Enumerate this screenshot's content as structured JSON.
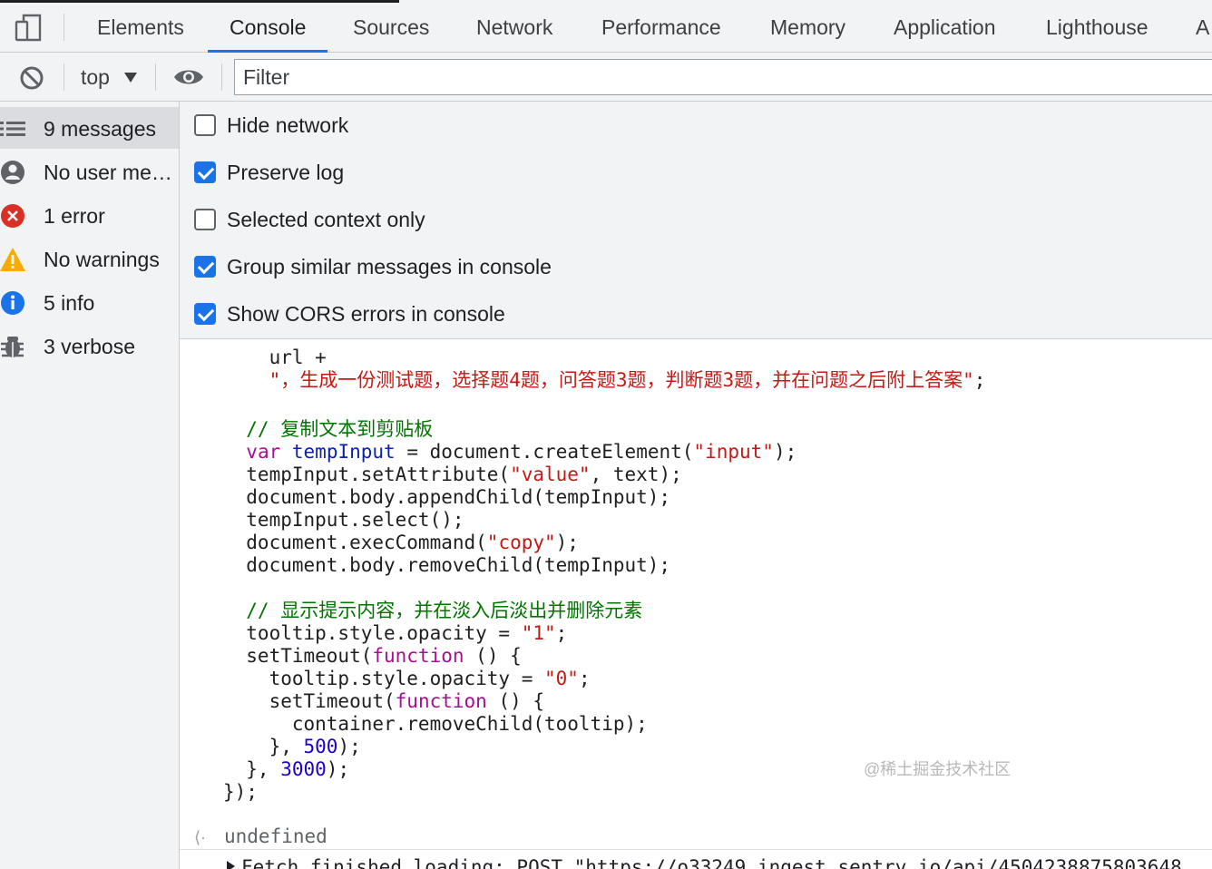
{
  "tabs": [
    {
      "label": "Elements",
      "active": false
    },
    {
      "label": "Console",
      "active": true
    },
    {
      "label": "Sources",
      "active": false
    },
    {
      "label": "Network",
      "active": false
    },
    {
      "label": "Performance",
      "active": false
    },
    {
      "label": "Memory",
      "active": false
    },
    {
      "label": "Application",
      "active": false
    },
    {
      "label": "Lighthouse",
      "active": false
    },
    {
      "label": "A",
      "active": false
    }
  ],
  "toolbar": {
    "context": "top",
    "filter_placeholder": "Filter",
    "clear_icon": "block-icon",
    "eye_icon": "eye-icon"
  },
  "sidebar": {
    "items": [
      {
        "label": "9 messages",
        "icon": "list-icon",
        "active": true
      },
      {
        "label": "No user messages",
        "icon": "user-icon",
        "active": false
      },
      {
        "label": "1 error",
        "icon": "error-icon",
        "active": false
      },
      {
        "label": "No warnings",
        "icon": "warning-icon",
        "active": false
      },
      {
        "label": "5 info",
        "icon": "info-icon",
        "active": false
      },
      {
        "label": "3 verbose",
        "icon": "bug-icon",
        "active": false
      }
    ]
  },
  "settings": {
    "options": [
      {
        "label": "Hide network",
        "checked": false
      },
      {
        "label": "Preserve log",
        "checked": true
      },
      {
        "label": "Selected context only",
        "checked": false
      },
      {
        "label": "Group similar messages in console",
        "checked": true
      },
      {
        "label": "Show CORS errors in console",
        "checked": true
      }
    ]
  },
  "console": {
    "code_lines": [
      [
        {
          "t": "    url +",
          "c": ""
        }
      ],
      [
        {
          "t": "    \"，生成一份测试题，选择题4题，问答题3题，判断题3题，并在问题之后附上答案\"",
          "c": "str"
        },
        {
          "t": ";",
          "c": ""
        }
      ],
      [
        {
          "t": "",
          "c": ""
        }
      ],
      [
        {
          "t": "  // 复制文本到剪贴板",
          "c": "cmt"
        }
      ],
      [
        {
          "t": "  ",
          "c": ""
        },
        {
          "t": "var",
          "c": "kw"
        },
        {
          "t": " ",
          "c": ""
        },
        {
          "t": "tempInput",
          "c": "var"
        },
        {
          "t": " = document.createElement(",
          "c": ""
        },
        {
          "t": "\"input\"",
          "c": "str"
        },
        {
          "t": ");",
          "c": ""
        }
      ],
      [
        {
          "t": "  tempInput.setAttribute(",
          "c": ""
        },
        {
          "t": "\"value\"",
          "c": "str"
        },
        {
          "t": ", text);",
          "c": ""
        }
      ],
      [
        {
          "t": "  document.body.appendChild(tempInput);",
          "c": ""
        }
      ],
      [
        {
          "t": "  tempInput.select();",
          "c": ""
        }
      ],
      [
        {
          "t": "  document.execCommand(",
          "c": ""
        },
        {
          "t": "\"copy\"",
          "c": "str"
        },
        {
          "t": ");",
          "c": ""
        }
      ],
      [
        {
          "t": "  document.body.removeChild(tempInput);",
          "c": ""
        }
      ],
      [
        {
          "t": "",
          "c": ""
        }
      ],
      [
        {
          "t": "  // 显示提示内容，并在淡入后淡出并删除元素",
          "c": "cmt"
        }
      ],
      [
        {
          "t": "  tooltip.style.opacity = ",
          "c": ""
        },
        {
          "t": "\"1\"",
          "c": "str"
        },
        {
          "t": ";",
          "c": ""
        }
      ],
      [
        {
          "t": "  setTimeout(",
          "c": ""
        },
        {
          "t": "function",
          "c": "kw"
        },
        {
          "t": " () {",
          "c": ""
        }
      ],
      [
        {
          "t": "    tooltip.style.opacity = ",
          "c": ""
        },
        {
          "t": "\"0\"",
          "c": "str"
        },
        {
          "t": ";",
          "c": ""
        }
      ],
      [
        {
          "t": "    setTimeout(",
          "c": ""
        },
        {
          "t": "function",
          "c": "kw"
        },
        {
          "t": " () {",
          "c": ""
        }
      ],
      [
        {
          "t": "      container.removeChild(tooltip);",
          "c": ""
        }
      ],
      [
        {
          "t": "    }, ",
          "c": ""
        },
        {
          "t": "500",
          "c": "num"
        },
        {
          "t": ");",
          "c": ""
        }
      ],
      [
        {
          "t": "  }, ",
          "c": ""
        },
        {
          "t": "3000",
          "c": "num"
        },
        {
          "t": ");",
          "c": ""
        }
      ],
      [
        {
          "t": "});",
          "c": ""
        }
      ]
    ],
    "result": "undefined",
    "fetch_message": "Fetch finished loading: POST \"https://o33249.ingest.sentry.io/api/4504238875803648",
    "watermark": "@稀土掘金技术社区"
  },
  "colors": {
    "accent": "#1a73e8",
    "error": "#d93025",
    "warning": "#f9ab00",
    "info": "#1a73e8"
  }
}
